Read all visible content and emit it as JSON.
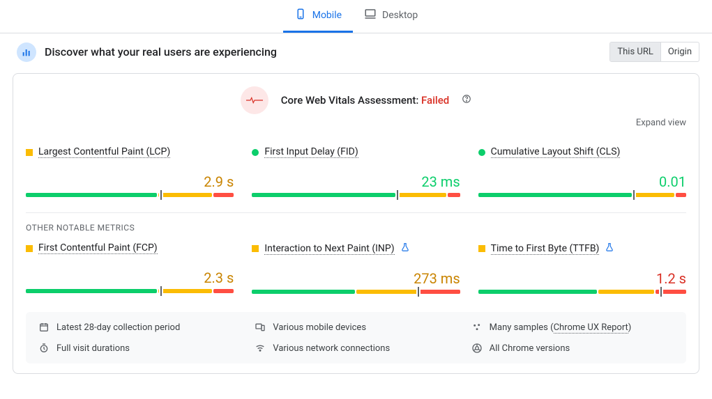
{
  "tabs": {
    "mobile": "Mobile",
    "desktop": "Desktop"
  },
  "header": {
    "title": "Discover what your real users are experiencing",
    "seg_this_url": "This URL",
    "seg_origin": "Origin"
  },
  "assessment": {
    "prefix": "Core Web Vitals Assessment: ",
    "status": "Failed",
    "expand": "Expand view"
  },
  "section_label": "OTHER NOTABLE METRICS",
  "metrics": {
    "lcp": {
      "name": "Largest Contentful Paint (LCP)",
      "value": "2.9 s"
    },
    "fid": {
      "name": "First Input Delay (FID)",
      "value": "23 ms"
    },
    "cls": {
      "name": "Cumulative Layout Shift (CLS)",
      "value": "0.01"
    },
    "fcp": {
      "name": "First Contentful Paint (FCP)",
      "value": "2.3 s"
    },
    "inp": {
      "name": "Interaction to Next Paint (INP)",
      "value": "273 ms"
    },
    "ttfb": {
      "name": "Time to First Byte (TTFB)",
      "value": "1.2 s"
    }
  },
  "footer": {
    "period": "Latest 28-day collection period",
    "devices": "Various mobile devices",
    "samples_pre": "Many samples (",
    "samples_link": "Chrome UX Report",
    "samples_post": ")",
    "durations": "Full visit durations",
    "networks": "Various network connections",
    "versions": "All Chrome versions"
  },
  "chart_data": [
    {
      "id": "lcp",
      "type": "bar",
      "good_pct": 64,
      "ni_pct": 26,
      "poor_pct": 10,
      "marker_pct": 65,
      "status": "needs-improvement"
    },
    {
      "id": "fid",
      "type": "bar",
      "good_pct": 70,
      "ni_pct": 24,
      "poor_pct": 6,
      "marker_pct": 70,
      "status": "good"
    },
    {
      "id": "cls",
      "type": "bar",
      "good_pct": 75,
      "ni_pct": 20,
      "poor_pct": 5,
      "marker_pct": 75,
      "status": "good"
    },
    {
      "id": "fcp",
      "type": "bar",
      "good_pct": 64,
      "ni_pct": 26,
      "poor_pct": 10,
      "marker_pct": 65,
      "status": "needs-improvement"
    },
    {
      "id": "inp",
      "type": "bar",
      "good_pct": 50,
      "ni_pct": 30,
      "poor_pct": 20,
      "marker_pct": 80,
      "status": "needs-improvement"
    },
    {
      "id": "ttfb",
      "type": "bar",
      "good_pct": 58,
      "ni_pct": 27,
      "poor_pct": 15,
      "marker_pct": 88,
      "status": "needs-improvement"
    }
  ]
}
